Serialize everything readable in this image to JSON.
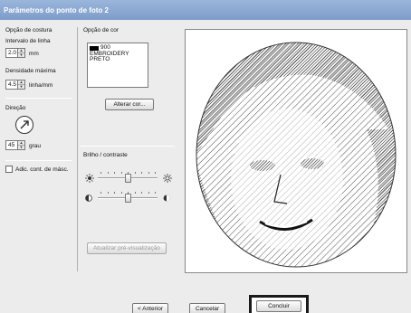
{
  "window": {
    "title": "Parâmetros do ponto de foto 2"
  },
  "stitch_options": {
    "group_label": "Opção de costura",
    "line_interval_label": "Intervalo de linha",
    "line_interval_value": "2.0",
    "line_interval_unit": "mm",
    "max_density_label": "Densidade máxima",
    "max_density_value": "4.5",
    "max_density_unit": "linha/mm",
    "direction_label": "Direção",
    "direction_value": "45",
    "direction_unit": "grau",
    "add_outline_label": "Adic. cont. de másc."
  },
  "color_options": {
    "group_label": "Opção de cor",
    "colors": [
      {
        "code": "900",
        "line2": "EMBROIDERY",
        "line3": "PRETO",
        "swatch": "#000000"
      }
    ],
    "change_color_button": "Alterar cor..."
  },
  "brightness": {
    "label": "Brilho / contraste",
    "brightness_level": 0.5,
    "contrast_level": 0.5
  },
  "update_preview_button": "Atualizar pré-visualização",
  "footer": {
    "back_button": "< Anterior",
    "cancel_button": "Cancelar",
    "finish_button": "Concluir"
  },
  "icons": [
    "sun-icon",
    "contrast-icon",
    "direction-dial-icon",
    "spin-arrows-icon"
  ]
}
